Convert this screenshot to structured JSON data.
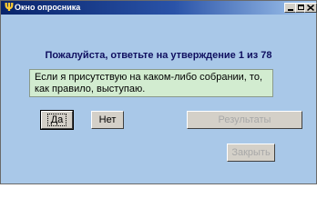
{
  "window": {
    "title": "Окно опросника",
    "app_icon": "psi-icon"
  },
  "titlebar_buttons": {
    "minimize": "minimize-icon",
    "maximize": "maximize-icon",
    "close": "close-icon"
  },
  "main": {
    "question": "Пожалуйста, ответьте на утверждение 1 из 78",
    "statement": "Если я присутствую на каком-либо собрании, то, как правило, выступаю."
  },
  "buttons": {
    "yes": "Да",
    "no": "Нет",
    "results": "Результаты",
    "close": "Закрыть"
  },
  "colors": {
    "window_bg": "#a9c8e8",
    "title_start": "#08246b",
    "title_end": "#a6caf0",
    "question_text": "#101060",
    "statement_bg": "#d2ecd0"
  }
}
